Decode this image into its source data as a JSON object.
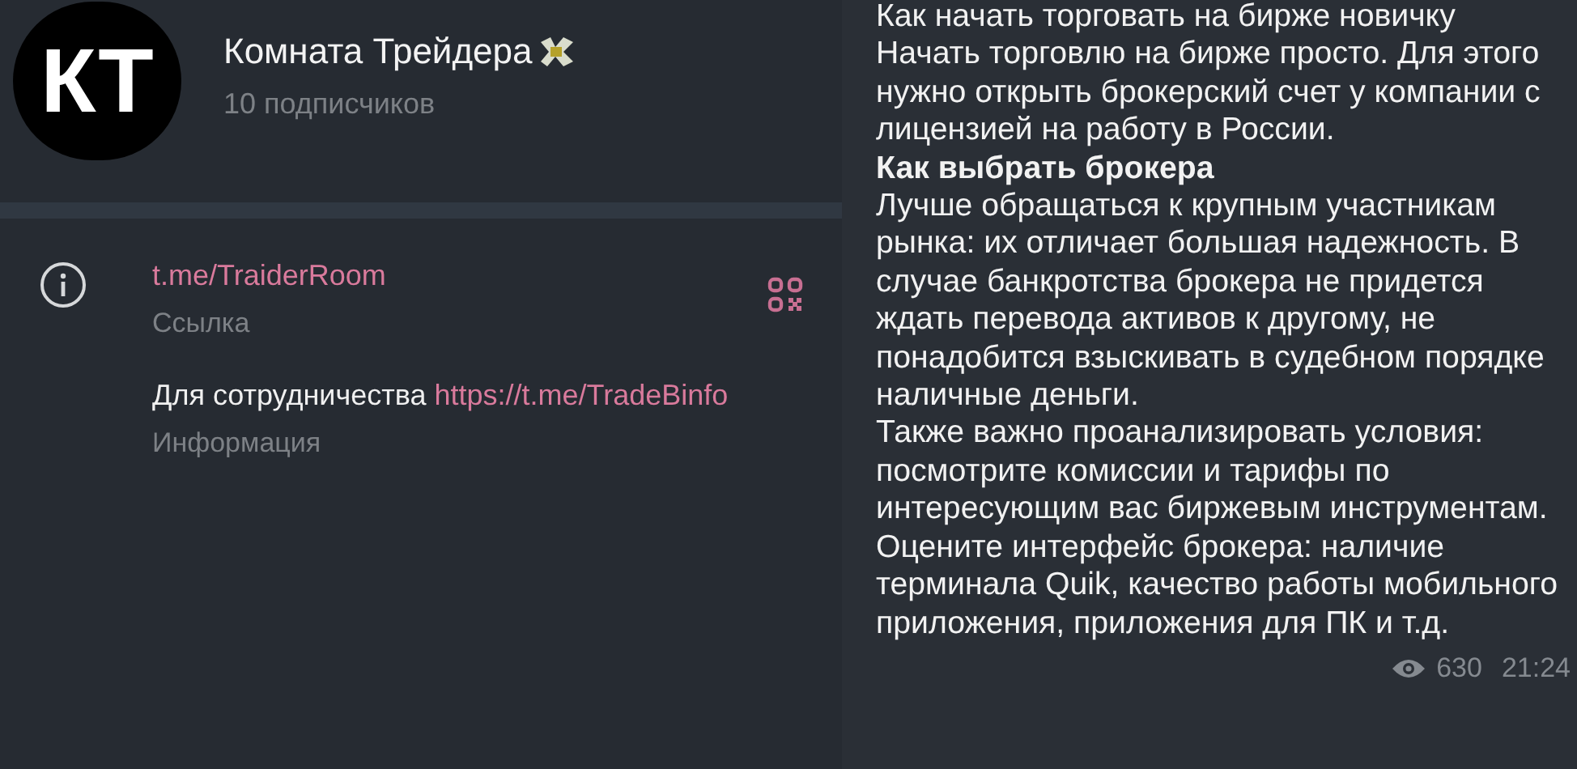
{
  "channel": {
    "avatar_text": "КТ",
    "name": "Комната Трейдера",
    "subscribers": "10 подписчиков"
  },
  "info": [
    {
      "kind": "link",
      "value": "t.me/TraiderRoom",
      "label": "Ссылка"
    },
    {
      "kind": "about",
      "value": "Для сотрудничества",
      "link": "https://t.me/TradeBinfo",
      "label": "Информация"
    }
  ],
  "message": {
    "paragraphs": [
      {
        "kind": "text",
        "text": "Как начать торговать на бирже новичку"
      },
      {
        "kind": "text",
        "text": "Начать торговлю на бирже просто. Для этого нужно открыть брокерский счет у компании с лицензией на работу в России."
      },
      {
        "kind": "heading",
        "text": "Как выбрать брокера"
      },
      {
        "kind": "text",
        "text": "Лучше обращаться к крупным участникам рынка: их отличает большая надежность. В случае банкротства брокера не придется ждать перевода активов к другому, не понадобится взыскивать в судебном порядке наличные деньги."
      },
      {
        "kind": "text",
        "text": "Также важно проанализировать условия: посмотрите комиссии и тарифы по интересующим вас биржевым инструментам."
      },
      {
        "kind": "text",
        "text": "Оцените интерфейс брокера: наличие терминала Quik, качество работы мобильного приложения, приложения для ПК и т.д."
      }
    ],
    "views": "630",
    "time": "21:24"
  }
}
